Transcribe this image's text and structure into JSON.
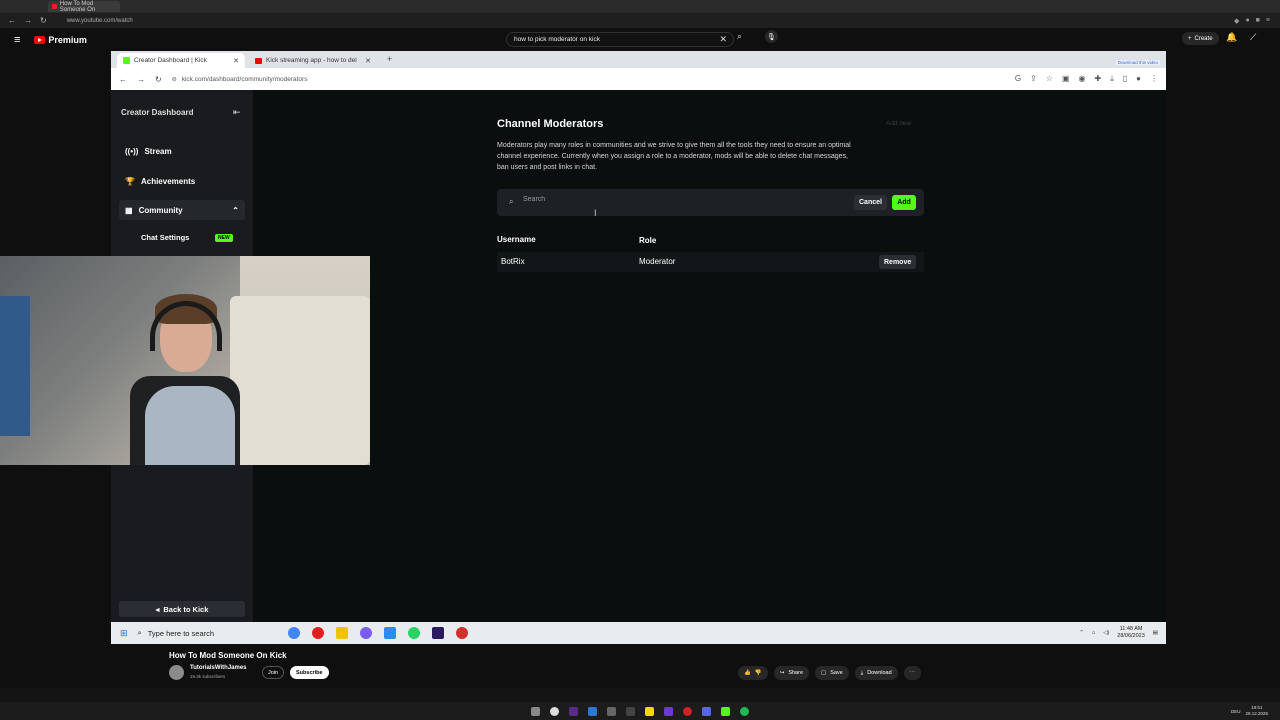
{
  "outer_browser": {
    "tab_title": "How To Mod Someone On",
    "url": "www.youtube.com/watch"
  },
  "youtube_header": {
    "logo_text": "Premium",
    "search_query": "how to pick moderator on kick",
    "create_label": "Create"
  },
  "inner_browser": {
    "tabs": [
      {
        "label": "Creator Dashboard | Kick"
      },
      {
        "label": "Kick streaming app - how to del"
      }
    ],
    "url": "kick.com/dashboard/community/moderators",
    "download_hint": "Download this video"
  },
  "sidebar": {
    "title": "Creator Dashboard",
    "items": [
      {
        "label": "Stream",
        "icon": "broadcast-icon"
      },
      {
        "label": "Achievements",
        "icon": "trophy-icon"
      },
      {
        "label": "Community",
        "icon": "community-icon"
      }
    ],
    "sub_item": "Chat Settings",
    "new_badge": "NEW",
    "back_label": "Back to Kick"
  },
  "main": {
    "title": "Channel Moderators",
    "add_new": "Add new",
    "description": "Moderators play many roles in communities and we strive to give them all the tools they need to ensure an optimal channel experience. Currently when you assign a role to a moderator, mods will be able to delete chat messages, ban users and post links in chat.",
    "search_placeholder": "Search",
    "cancel_label": "Cancel",
    "add_label": "Add",
    "columns": {
      "username": "Username",
      "role": "Role"
    },
    "moderators": [
      {
        "username": "BotRix",
        "role": "Moderator",
        "action": "Remove"
      }
    ]
  },
  "taskbar": {
    "search_placeholder": "Type here to search",
    "time": "11:48 AM",
    "date": "28/06/2023"
  },
  "video": {
    "title": "How To Mod Someone On Kick",
    "channel": "TutorialsWithJames",
    "subscribers": "19.3k subscribers",
    "join_label": "Join",
    "subscribe_label": "Subscribe",
    "share_label": "Share",
    "save_label": "Save",
    "download_label": "Download"
  },
  "host_tray": {
    "time": "18:51",
    "date": "28.12.2025",
    "lang": "DEU"
  },
  "colors": {
    "kick_green": "#53fc18",
    "youtube_red": "#ff0000"
  }
}
